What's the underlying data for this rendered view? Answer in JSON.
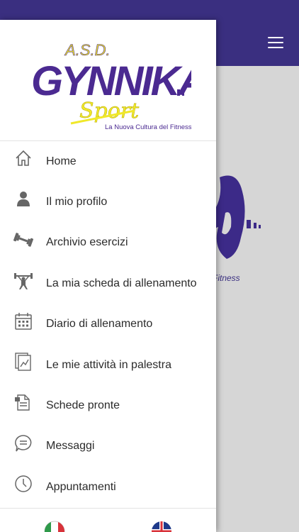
{
  "app": {
    "logo_top": "A.S.D.",
    "logo_main": "GYNNIKA",
    "logo_sport": "Sport",
    "logo_tagline": "La Nuova Cultura del Fitness",
    "bg_tagline": "Fitness"
  },
  "colors": {
    "brand": "#3a2f80",
    "logo_purple": "#4b2a91",
    "logo_yellow": "#f0e82a"
  },
  "menu": {
    "items": [
      {
        "label": "Home",
        "icon": "home-icon"
      },
      {
        "label": "Il mio profilo",
        "icon": "user-icon"
      },
      {
        "label": "Archivio esercizi",
        "icon": "dumbbell-icon"
      },
      {
        "label": "La mia scheda di allenamento",
        "icon": "weightlifter-icon"
      },
      {
        "label": "Diario di allenamento",
        "icon": "calendar-icon"
      },
      {
        "label": "Le mie attività in palestra",
        "icon": "activity-report-icon"
      },
      {
        "label": "Schede pronte",
        "icon": "ready-sheets-icon"
      },
      {
        "label": "Messaggi",
        "icon": "chat-icon"
      },
      {
        "label": "Appuntamenti",
        "icon": "clock-icon"
      }
    ]
  },
  "footer": {
    "flags": [
      "italian-flag-icon",
      "uk-flag-icon"
    ]
  }
}
